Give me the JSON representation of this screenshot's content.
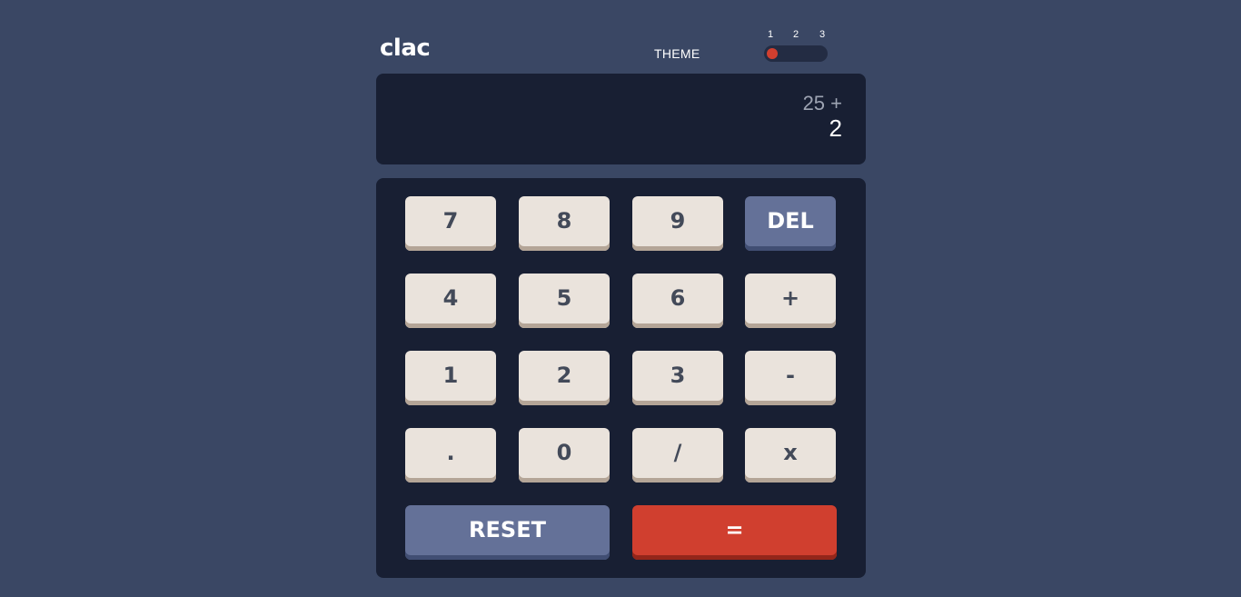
{
  "header": {
    "logo": "clac",
    "theme_label": "THEME",
    "theme_options": [
      "1",
      "2",
      "3"
    ],
    "active_theme": "1"
  },
  "display": {
    "previous": "25 +",
    "current": "2"
  },
  "keys": {
    "k7": "7",
    "k8": "8",
    "k9": "9",
    "del": "DEL",
    "k4": "4",
    "k5": "5",
    "k6": "6",
    "plus": "+",
    "k1": "1",
    "k2": "2",
    "k3": "3",
    "minus": "-",
    "dot": ".",
    "k0": "0",
    "divide": "/",
    "multiply": "x",
    "reset": "RESET",
    "equals": "="
  },
  "colors": {
    "background": "#3a4764",
    "screen": "#181f33",
    "key": "#eae3dc",
    "key_text": "#434a59",
    "key_alt": "#647198",
    "accent": "#d03f2f"
  }
}
